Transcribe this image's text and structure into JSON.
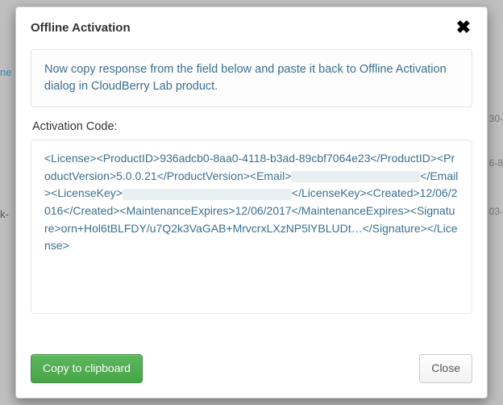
{
  "modal": {
    "title": "Offline Activation",
    "info": "Now copy response from the field below and paste it back to Offline Activation dialog in CloudBerry Lab product.",
    "code_label": "Activation Code:",
    "code_parts": {
      "p1": "<License><ProductID>936adcb0-8aa0-4118-b3ad-89cbf7064e23</ProductID><ProductVersion>5.0.0.21</ProductVersion><Email>",
      "p2": "</Email><LicenseKey>",
      "p3": "</LicenseKey><Created>12/06/2016</Created><MaintenanceExpires>12/06/2017</MaintenanceExpires><Signature>orn+Hol6tBLFDY/u7Q2k3VaGAB+MrvcrxLXzNP5lYBLUDt…</Signature></License>"
    },
    "copy_label": "Copy to clipboard",
    "close_label": "Close"
  },
  "bg": {
    "a": "30-",
    "b": "6-8",
    "c": "03-",
    "left1": "ne",
    "left2": "k-"
  }
}
